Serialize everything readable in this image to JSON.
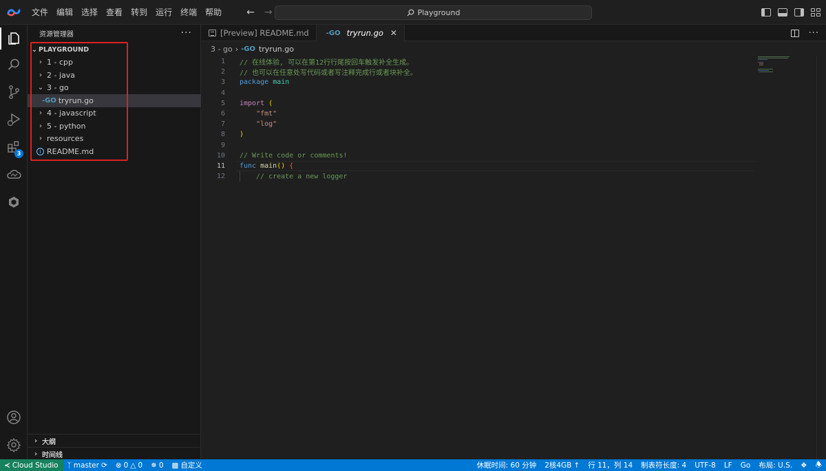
{
  "menubar": {
    "items": [
      "文件",
      "编辑",
      "选择",
      "查看",
      "转到",
      "运行",
      "终端",
      "帮助"
    ]
  },
  "command_center": {
    "label": "Playground"
  },
  "activity_bar": {
    "extensions_badge": "3"
  },
  "sidebar": {
    "title": "资源管理器",
    "root": "PLAYGROUND",
    "items": [
      {
        "label": "1 - cpp",
        "expanded": false
      },
      {
        "label": "2 - java",
        "expanded": false
      },
      {
        "label": "3 - go",
        "expanded": true
      },
      {
        "label": "tryrun.go",
        "file_icon": "go-icon",
        "selected": true
      },
      {
        "label": "4 - javascript",
        "expanded": false
      },
      {
        "label": "5 - python",
        "expanded": false
      },
      {
        "label": "resources",
        "expanded": false
      },
      {
        "label": "README.md",
        "file_icon": "info-icon"
      }
    ],
    "outline_label": "大纲",
    "timeline_label": "时间线"
  },
  "tabs": [
    {
      "label": "[Preview] README.md",
      "active": false
    },
    {
      "label": "tryrun.go",
      "active": true
    }
  ],
  "breadcrumb": {
    "folder": "3 - go",
    "file": "tryrun.go"
  },
  "code": {
    "line_numbers": [
      "1",
      "2",
      "3",
      "4",
      "5",
      "6",
      "7",
      "8",
      "9",
      "10",
      "11",
      "12"
    ],
    "current_line": "11",
    "l1": "// 在线体验, 可以在第12行行尾按回车触发补全生成。",
    "l2": "// 也可以在任意处写代码或者写注释完成行或者块补全。",
    "l3_kw": "package",
    "l3_name": "main",
    "l5_kw": "import",
    "l5_paren": "(",
    "l6": "\"fmt\"",
    "l7": "\"log\"",
    "l8": ")",
    "l10": "// Write code or comments!",
    "l11_kw": "func",
    "l11_name": "main",
    "l11_parens": "()",
    "l11_brace": "{",
    "l12": "// create a new logger"
  },
  "statusbar": {
    "remote": "Cloud Studio",
    "branch": "master",
    "errors": "0",
    "warnings": "0",
    "ports": "0",
    "custom": "自定义",
    "idle_time": "休眠时间: 60 分钟",
    "resources": "2核4GB",
    "position": "行 11，列 14",
    "tab_size": "制表符长度: 4",
    "encoding": "UTF-8",
    "eol": "LF",
    "language": "Go",
    "layout": "布局: U.S."
  },
  "colors": {
    "statusbar_bg": "#0078d4",
    "remote_bg": "#16825d",
    "highlight_box": "#e02020"
  }
}
